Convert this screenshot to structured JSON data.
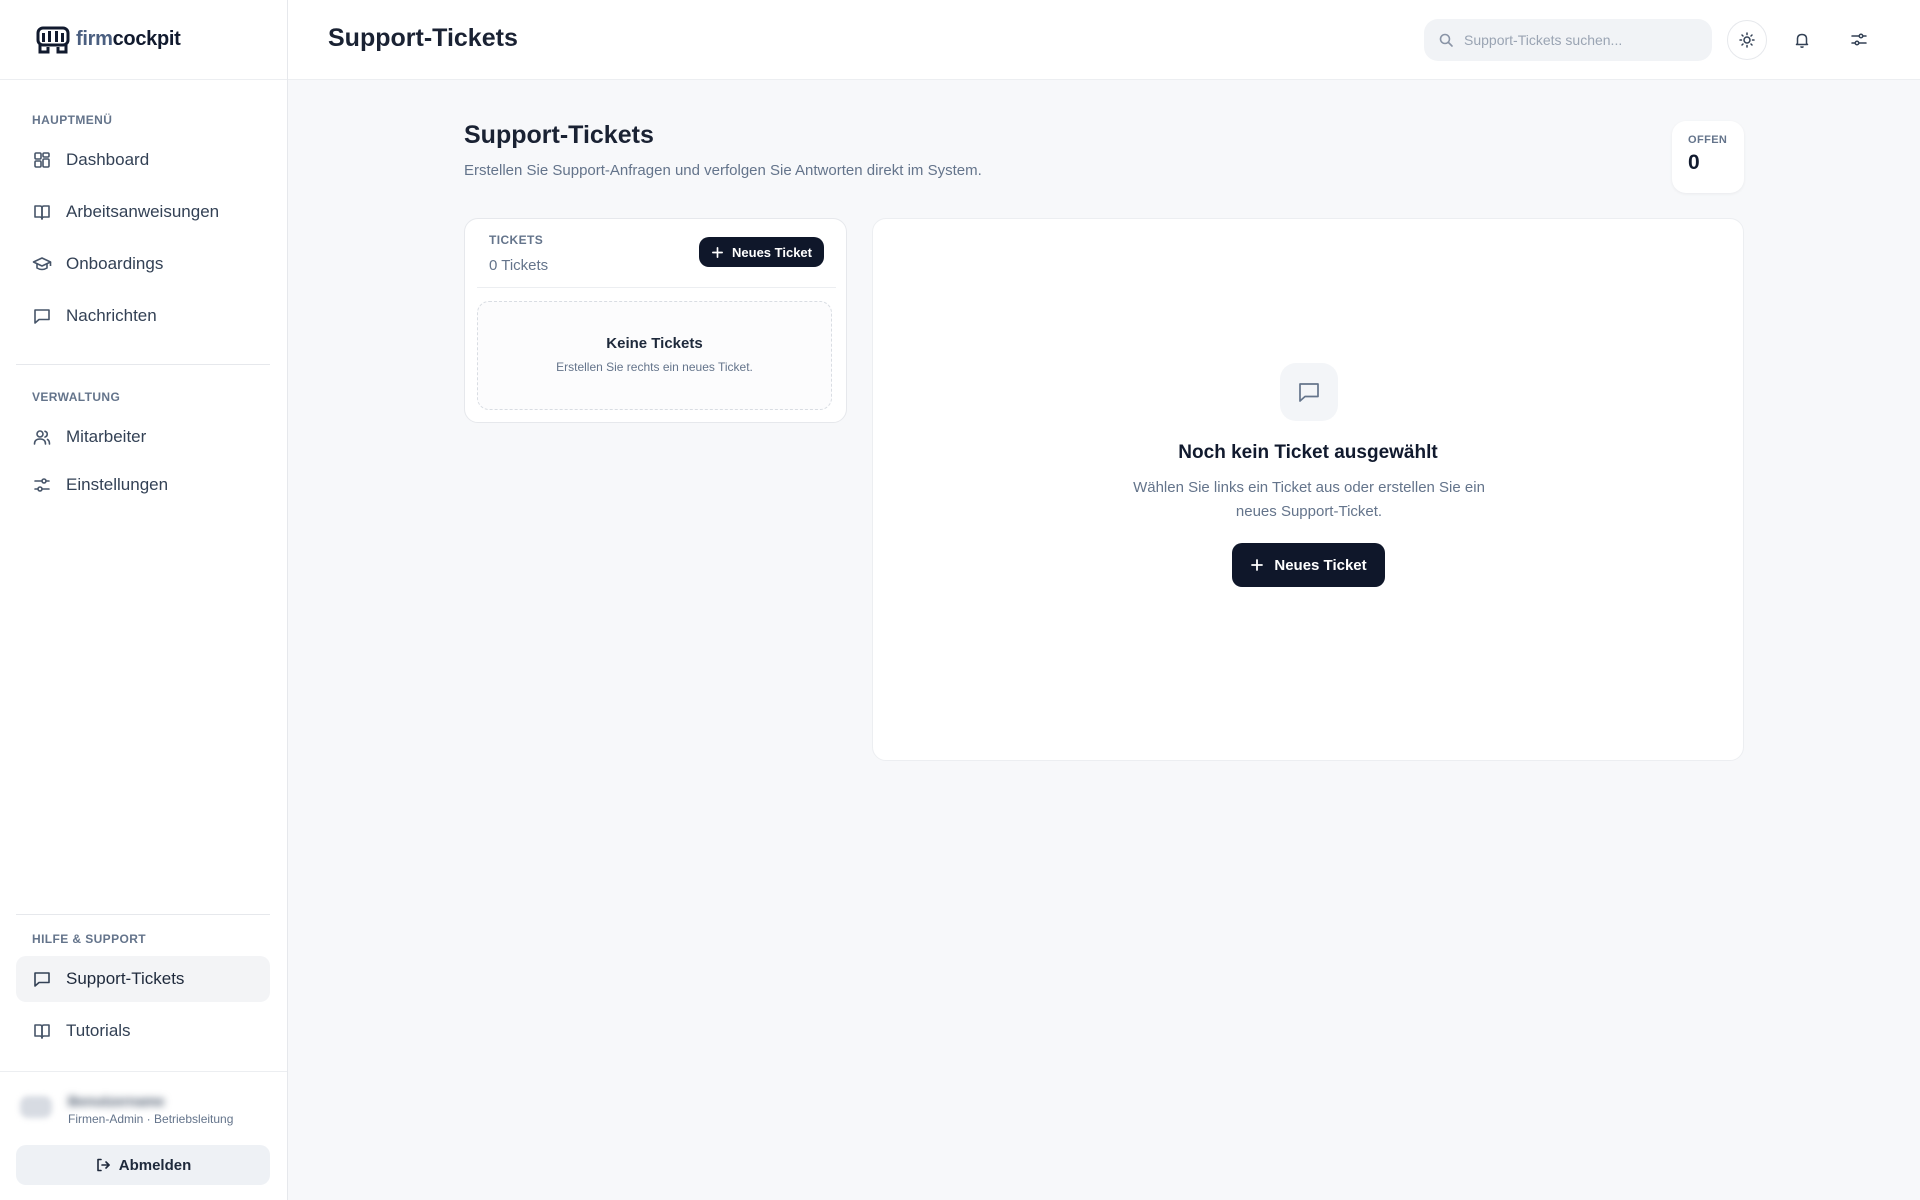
{
  "brand": {
    "light": "firm",
    "dark": "cockpit"
  },
  "sidebar": {
    "main_label": "HAUPTMENÜ",
    "main_items": [
      {
        "label": "Dashboard",
        "icon": "dashboard-grid-icon"
      },
      {
        "label": "Arbeitsanweisungen",
        "icon": "book-icon"
      },
      {
        "label": "Onboardings",
        "icon": "graduation-cap-icon"
      },
      {
        "label": "Nachrichten",
        "icon": "chat-icon"
      }
    ],
    "admin_label": "VERWALTUNG",
    "admin_items": [
      {
        "label": "Mitarbeiter",
        "icon": "users-icon"
      },
      {
        "label": "Einstellungen",
        "icon": "sliders-icon"
      }
    ],
    "help_label": "HILFE & SUPPORT",
    "help_items": [
      {
        "label": "Support-Tickets",
        "icon": "chat-icon",
        "active": true
      },
      {
        "label": "Tutorials",
        "icon": "book-icon"
      }
    ],
    "user": {
      "name": "Benutzername",
      "role": "Firmen-Admin · Betriebsleitung"
    },
    "logout_label": "Abmelden"
  },
  "topbar": {
    "title": "Support-Tickets",
    "search_placeholder": "Support-Tickets suchen..."
  },
  "page": {
    "title": "Support-Tickets",
    "subtitle": "Erstellen Sie Support-Anfragen und verfolgen Sie Antworten direkt im System.",
    "stat_label": "OFFEN",
    "stat_value": "0"
  },
  "ticket_list": {
    "label": "TICKETS",
    "count": "0 Tickets",
    "new_button": "Neues Ticket",
    "empty_title": "Keine Tickets",
    "empty_sub": "Erstellen Sie rechts ein neues Ticket."
  },
  "detail": {
    "title": "Noch kein Ticket ausgewählt",
    "subtitle": "Wählen Sie links ein Ticket aus oder erstellen Sie ein neues Support-Ticket.",
    "new_button": "Neues Ticket"
  },
  "colors": {
    "accent": "#0f172a",
    "muted": "#64748b",
    "background": "#f7f8fa"
  }
}
